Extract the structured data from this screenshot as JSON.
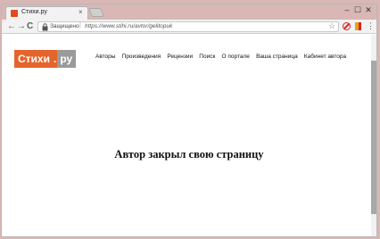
{
  "browser": {
    "tab_title": "Стихи.ру",
    "tab_close": "×",
    "window_controls": [
      "–",
      "☐",
      "✕"
    ],
    "nav": {
      "back": "←",
      "forward": "→",
      "reload": "C"
    },
    "omnibox": {
      "secure_label": "Защищено",
      "separator": "|",
      "url": "https://www.stihi.ru/avtor/gelitopuk"
    },
    "star": "☆",
    "menu": "⋮"
  },
  "site": {
    "logo_main": "Стихи",
    "logo_dot": ".",
    "logo_suffix": "ру",
    "nav_items": [
      {
        "label": "Авторы"
      },
      {
        "label": "Произведения"
      },
      {
        "label": "Рецензии"
      },
      {
        "label": "Поиск"
      },
      {
        "label": "О портале"
      },
      {
        "label": "Ваша страница"
      },
      {
        "label": "Кабинет автора"
      }
    ],
    "headline": "Автор закрыл свою страницу"
  },
  "colors": {
    "logo_orange": "#e5642b",
    "logo_gray": "#9a9a9a",
    "desktop": "#d8b7b4"
  }
}
